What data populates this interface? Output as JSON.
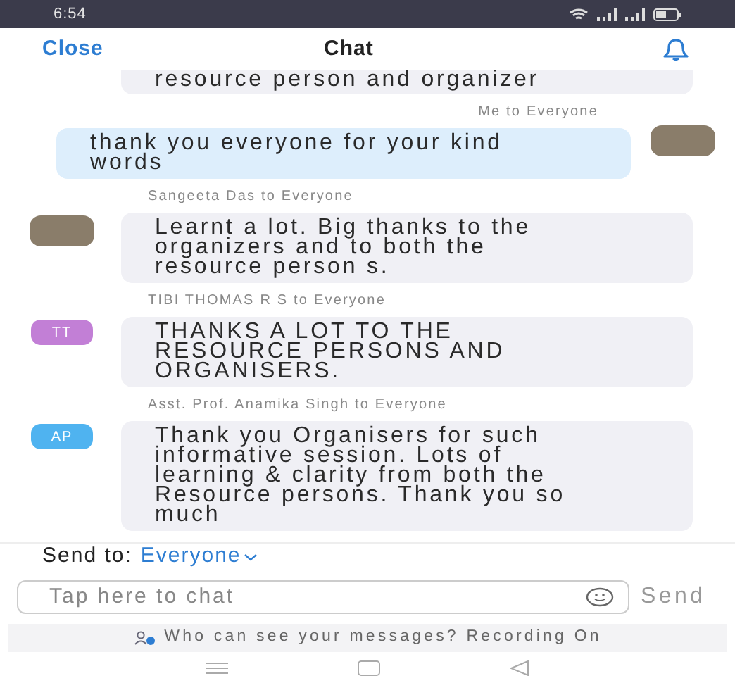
{
  "status_bar": {
    "time": "6:54"
  },
  "header": {
    "close": "Close",
    "title": "Chat"
  },
  "messages": [
    {
      "kind": "other",
      "text": "resource person and organizer",
      "avatar": {
        "kind": "none"
      }
    },
    {
      "kind": "me",
      "sender": "Me to Everyone",
      "text": "thank you everyone for your kind words",
      "avatar": {
        "kind": "photo"
      }
    },
    {
      "kind": "other",
      "sender": "Sangeeta Das to Everyone",
      "text": "Learnt a lot. Big thanks to the organizers  and to both the resource person s.",
      "avatar": {
        "kind": "photo"
      }
    },
    {
      "kind": "other",
      "sender": "TIBI THOMAS R S to Everyone",
      "text": "THANKS A LOT TO THE RESOURCE PERSONS AND ORGANISERS.",
      "avatar": {
        "kind": "initials",
        "initials": "TT",
        "color": "#c27fd6"
      }
    },
    {
      "kind": "other",
      "sender": "Asst. Prof. Anamika Singh to Everyone",
      "text": "Thank you Organisers for such informative session. Lots of learning & clarity from both the Resource persons. Thank you so much",
      "avatar": {
        "kind": "initials",
        "initials": "AP",
        "color": "#4fb3f0"
      }
    }
  ],
  "send_to": {
    "label": "Send to:",
    "value": "Everyone"
  },
  "composer": {
    "placeholder": "Tap here to chat",
    "send": "Send"
  },
  "notice": "Who can see your messages? Recording On"
}
